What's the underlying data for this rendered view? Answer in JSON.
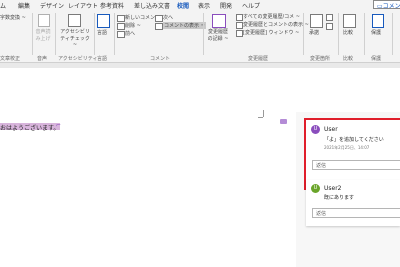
{
  "tabs": [
    {
      "label": "ム"
    },
    {
      "label": "編集"
    },
    {
      "label": "デザイン"
    },
    {
      "label": "レイアウト"
    },
    {
      "label": "参考資料"
    },
    {
      "label": "差し込み文書"
    },
    {
      "label": "校閲"
    },
    {
      "label": "表示"
    },
    {
      "label": "開発"
    },
    {
      "label": "ヘルプ"
    }
  ],
  "active_tab": "校閲",
  "comments_button": "コメント",
  "ribbon": {
    "proofing_top": "字数変換 ~",
    "proofing_label": "文章校正",
    "speech_btn": "音声読み上げ",
    "speech_label": "音声",
    "access_btn": "アクセシビリティチェック ~",
    "access_label": "アクセシビリティ",
    "lang_btn": "言語",
    "lang_label": "言語",
    "new_comment": "新しいコメント",
    "delete": "削除 ~",
    "prev": "前へ",
    "next": "次へ",
    "show_comments": "コメントの表示 ~",
    "comment_group": "コメント",
    "track_btn": "変更履歴の記録 ~",
    "track_display": "すべての変更履歴/コメ ~",
    "track_show": "変更履歴とコメントの表示 ~",
    "track_pane": "[変更履歴] ウィンドウ ~",
    "track_label": "変更履歴",
    "accept": "承諾",
    "changes_label": "変更箇所",
    "compare": "比較",
    "compare_label": "比較",
    "protect": "保護",
    "protect_label": "保護"
  },
  "document": {
    "selected_text": "おはようございます。"
  },
  "comments": [
    {
      "avatar": "U",
      "author": "User",
      "text": "「よ」を追加してください",
      "time": "2021年2月25日、14:07",
      "reply_placeholder": "返信",
      "avatar_color": "#8a4dbd"
    },
    {
      "avatar": "U",
      "author": "User2",
      "text": "既にあります",
      "reply_placeholder": "返信",
      "avatar_color": "#6aa52a"
    }
  ]
}
